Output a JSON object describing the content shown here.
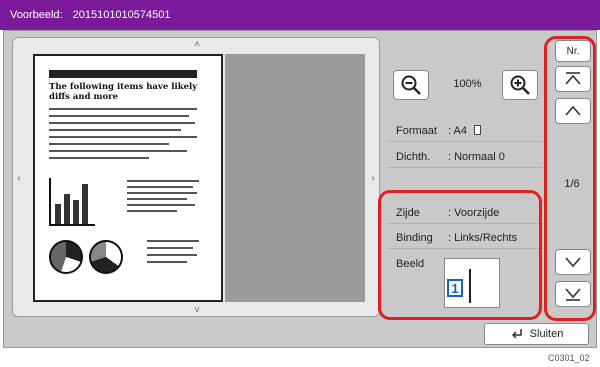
{
  "titlebar": {
    "label": "Voorbeeld:",
    "doc_id": "2015101010574501"
  },
  "preview": {
    "heading": "The following items have likely diffs and more",
    "icons": {
      "scroll_up": "chevron-up-icon",
      "scroll_down": "chevron-down-icon",
      "scroll_left": "chevron-left-icon",
      "scroll_right": "chevron-right-icon"
    }
  },
  "zoom": {
    "value": "100%",
    "out_icon": "zoom-out-icon",
    "in_icon": "zoom-in-icon"
  },
  "info": {
    "formaat_label": "Formaat",
    "formaat_value": ": A4",
    "dichth_label": "Dichth.",
    "dichth_value": ": Normaal 0",
    "zijde_label": "Zijde",
    "zijde_value": ": Voorzijde",
    "binding_label": "Binding",
    "binding_value": ": Links/Rechts",
    "beeld_label": "Beeld",
    "beeld_value": "1"
  },
  "nav": {
    "nr_label": "Nr.",
    "page_indicator": "1/6"
  },
  "close_label": "Sluiten",
  "image_code": "C0301_02",
  "colors": {
    "titlebar": "#7a1a9a",
    "highlight": "#e02020",
    "beeld_accent": "#1565c0"
  }
}
